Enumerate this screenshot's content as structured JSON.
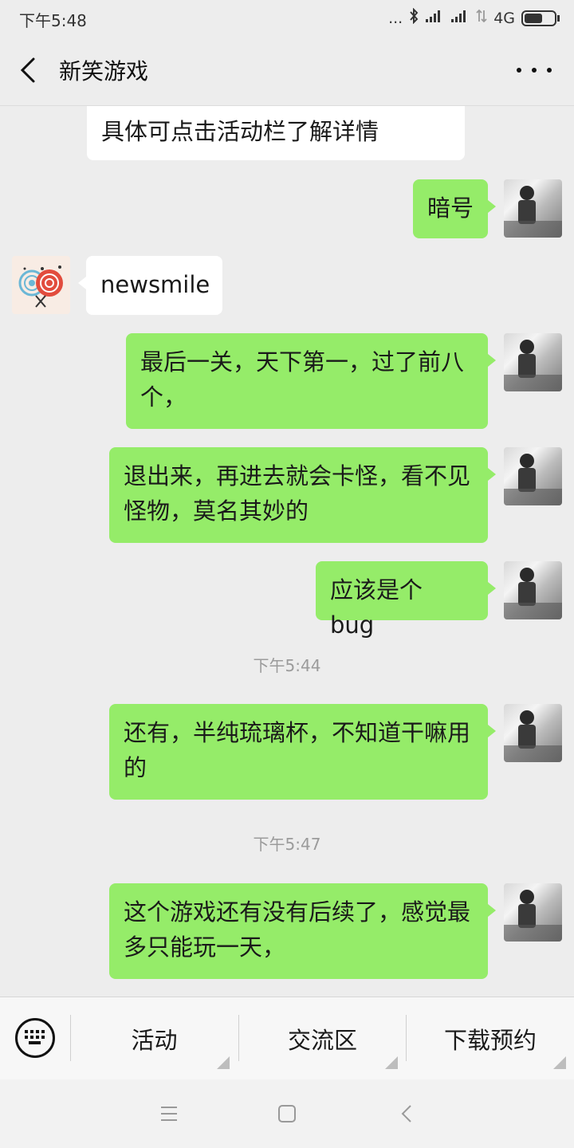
{
  "status_bar": {
    "time": "下午5:48",
    "network": "4G",
    "dots": "..."
  },
  "header": {
    "title": "新笑游戏"
  },
  "messages": [
    {
      "text": "具体可点击活动栏了解详情"
    },
    {
      "text": "暗号"
    },
    {
      "text": "newsmile"
    },
    {
      "text": "最后一关，天下第一，过了前八个，"
    },
    {
      "text": "退出来，再进去就会卡怪，看不见怪物，莫名其妙的"
    },
    {
      "text": "应该是个 bug"
    },
    {
      "text": "还有，半纯琉璃杯，不知道干嘛用的"
    },
    {
      "text": "这个游戏还有没有后续了，感觉最多只能玩一天，"
    }
  ],
  "timestamps": [
    "下午5:44",
    "下午5:47"
  ],
  "bottom_menu": {
    "items": [
      "活动",
      "交流区",
      "下载预约"
    ]
  },
  "colors": {
    "sent_bubble": "#95ec69",
    "received_bubble": "#ffffff",
    "background": "#ededed"
  }
}
